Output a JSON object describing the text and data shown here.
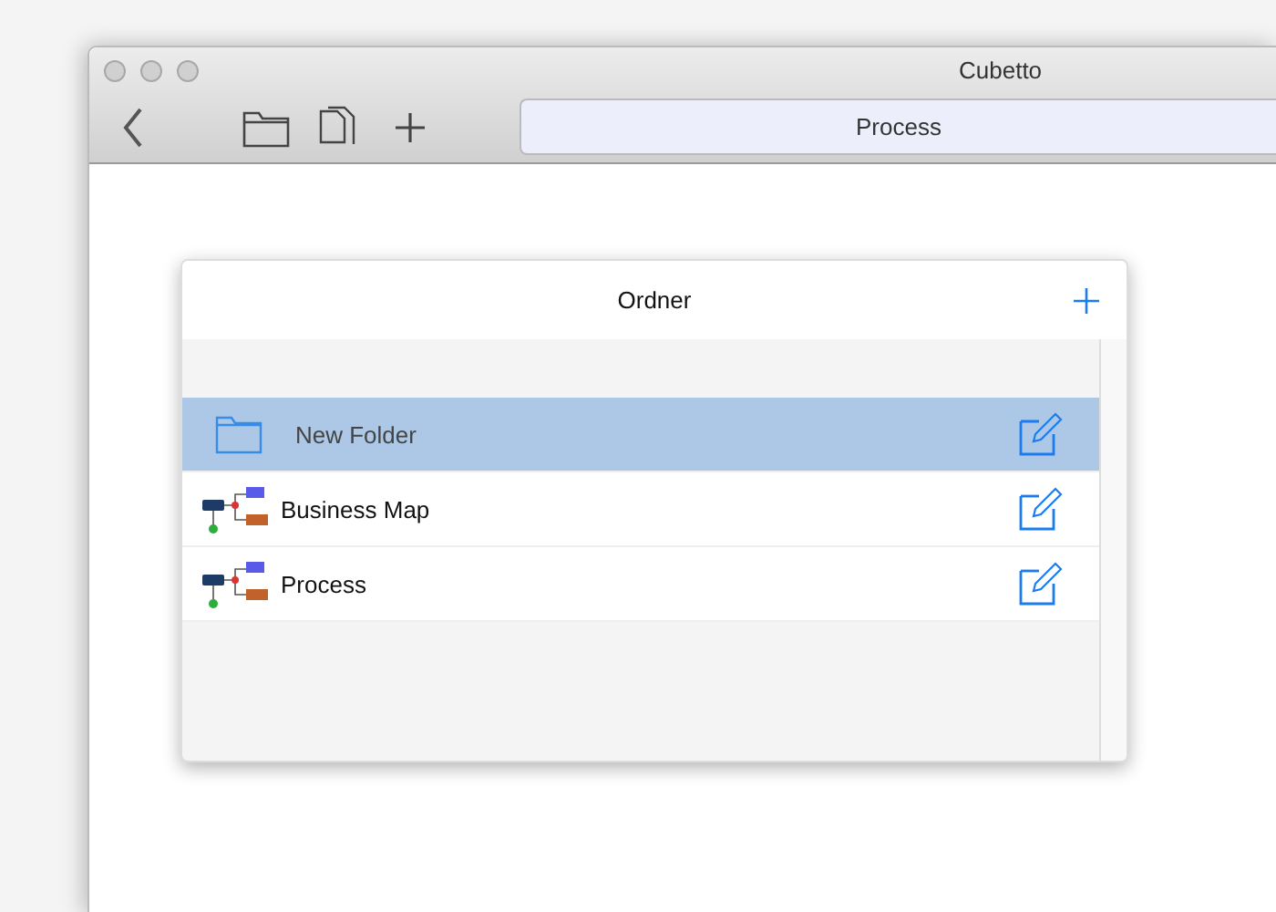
{
  "window": {
    "title": "Cubetto"
  },
  "toolbar": {
    "location": "Process"
  },
  "panel": {
    "title": "Ordner",
    "items": [
      {
        "kind": "folder",
        "label": "New Folder",
        "selected": true
      },
      {
        "kind": "map",
        "label": "Business Map",
        "selected": false
      },
      {
        "kind": "map",
        "label": "Process",
        "selected": false
      }
    ]
  }
}
